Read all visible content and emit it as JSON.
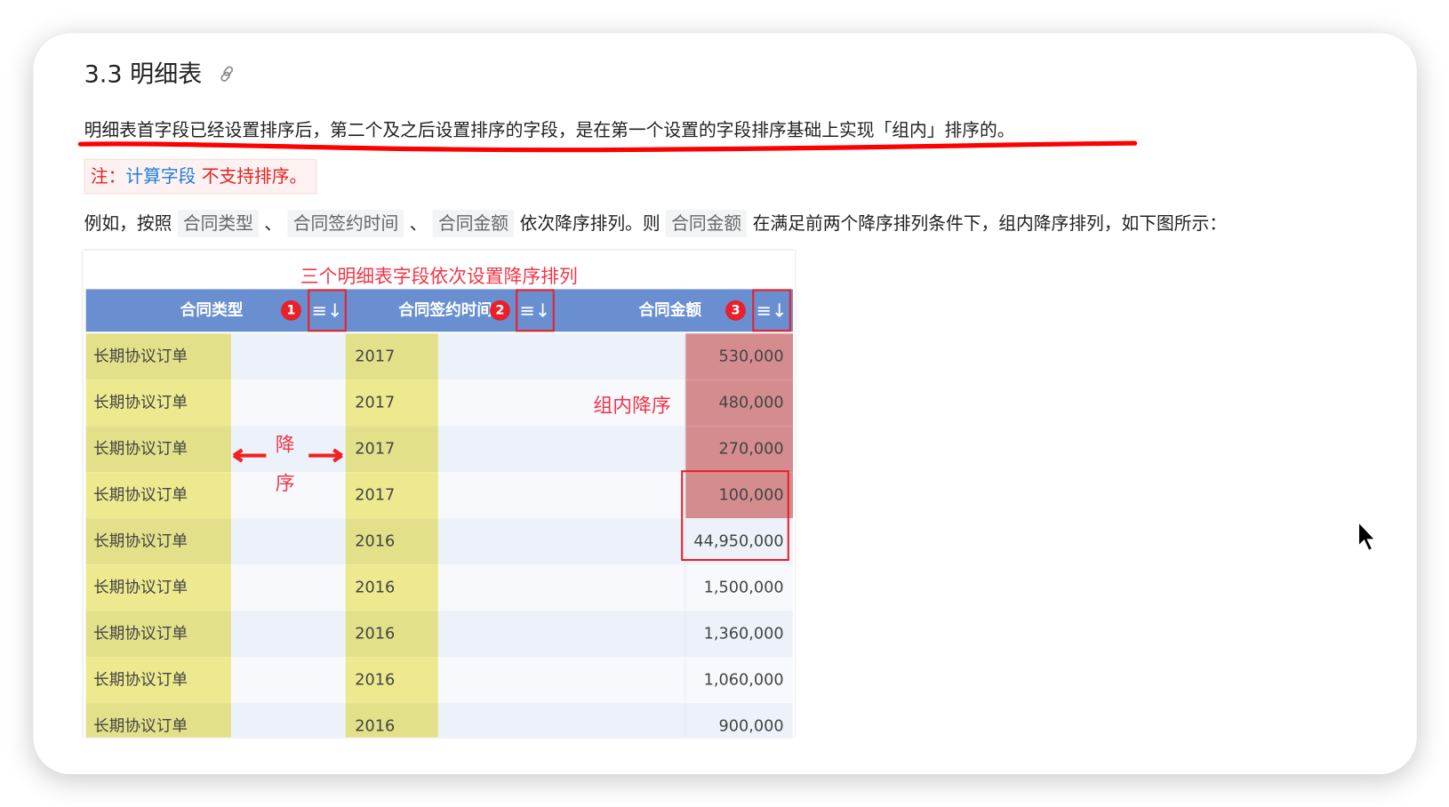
{
  "heading": {
    "title": "3.3 明细表"
  },
  "paragraph1": "明细表首字段已经设置排序后，第二个及之后设置排序的字段，是在第一个设置的字段排序基础上实现「组内」排序的。",
  "note": {
    "prefix": "注：",
    "link": "计算字段",
    "suffix": " 不支持排序。"
  },
  "paragraph2": {
    "t1": "例如，按照 ",
    "c1": "合同类型",
    "t2": " 、 ",
    "c2": "合同签约时间",
    "t3": " 、 ",
    "c3": "合同金额",
    "t4": " 依次降序排列。则 ",
    "c4": "合同金额",
    "t5": " 在满足前两个降序排列条件下，组内降序排列，如下图所示："
  },
  "figure": {
    "caption": "三个明细表字段依次设置降序排列",
    "headers": [
      {
        "label": "合同类型",
        "badge": "1"
      },
      {
        "label": "合同签约时间",
        "badge": "2"
      },
      {
        "label": "合同金额",
        "badge": "3"
      }
    ],
    "sort_icon": "≡↓",
    "rows": [
      {
        "type": "长期协议订单",
        "year": "2017",
        "amount": "530,000"
      },
      {
        "type": "长期协议订单",
        "year": "2017",
        "amount": "480,000"
      },
      {
        "type": "长期协议订单",
        "year": "2017",
        "amount": "270,000"
      },
      {
        "type": "长期协议订单",
        "year": "2017",
        "amount": "100,000"
      },
      {
        "type": "长期协议订单",
        "year": "2016",
        "amount": "44,950,000"
      },
      {
        "type": "长期协议订单",
        "year": "2016",
        "amount": "1,500,000"
      },
      {
        "type": "长期协议订单",
        "year": "2016",
        "amount": "1,360,000"
      },
      {
        "type": "长期协议订单",
        "year": "2016",
        "amount": "1,060,000"
      },
      {
        "type": "长期协议订单",
        "year": "2016",
        "amount": "900,000"
      }
    ],
    "annotations": {
      "group_desc": "组内降序",
      "desc_1": "降",
      "desc_2": "序"
    }
  }
}
